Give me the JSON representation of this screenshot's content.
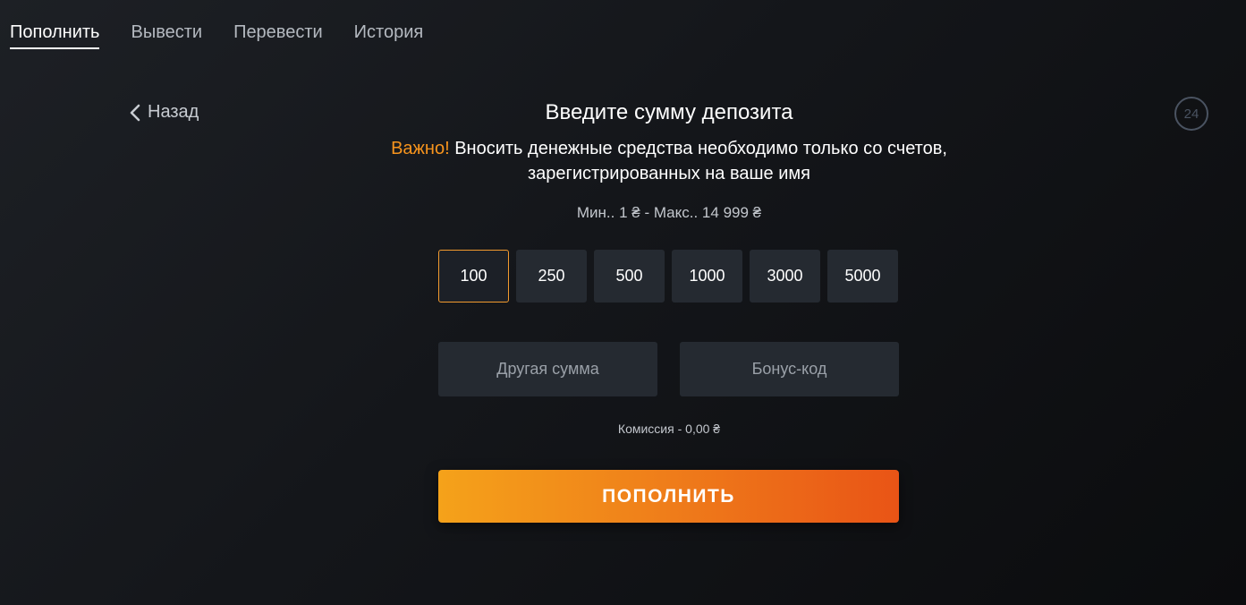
{
  "tabs": [
    {
      "label": "Пополнить",
      "active": true
    },
    {
      "label": "Вывести",
      "active": false
    },
    {
      "label": "Перевести",
      "active": false
    },
    {
      "label": "История",
      "active": false
    }
  ],
  "back": {
    "label": "Назад",
    "icon": "chevron-left-icon"
  },
  "support_badge": {
    "label": "24",
    "icon": "support-24-icon"
  },
  "title": "Введите сумму депозита",
  "warning": {
    "accent": "Важно!",
    "text": "Вносить денежные средства необходимо только со счетов,",
    "text_line2": "зарегистрированных на ваше имя"
  },
  "limits": "Мин.. 1 ₴ - Макс.. 14 999 ₴",
  "amounts": [
    "100",
    "250",
    "500",
    "1000",
    "3000",
    "5000"
  ],
  "selected_amount": "100",
  "inputs": {
    "other_amount_placeholder": "Другая сумма",
    "bonus_code_placeholder": "Бонус-код"
  },
  "commission": "Комиссия - 0,00 ₴",
  "submit_label": "ПОПОЛНИТЬ",
  "colors": {
    "accent": "#f7941d",
    "button_gradient_start": "#f5a21a",
    "button_gradient_end": "#e95416",
    "selected_border": "#f29a2e"
  }
}
